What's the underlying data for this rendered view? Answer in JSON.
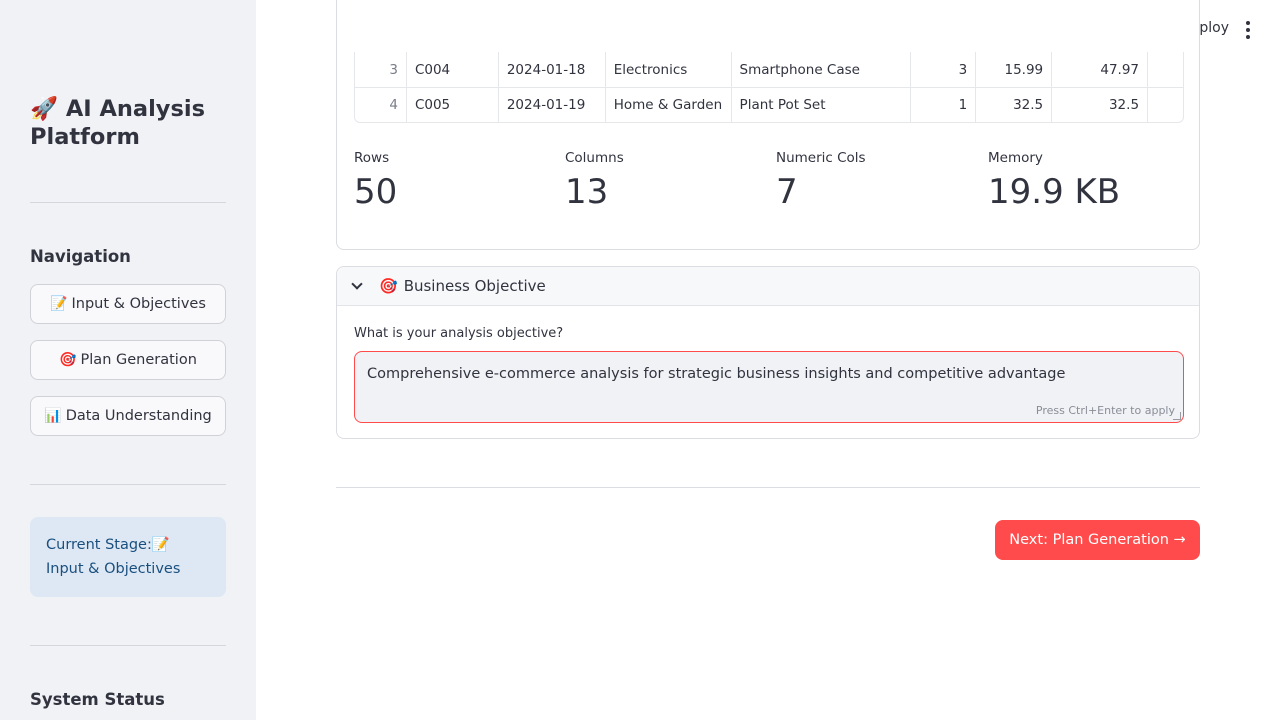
{
  "sidebar": {
    "title_icon": "🚀",
    "title": "AI Analysis Platform",
    "nav_heading": "Navigation",
    "nav_items": [
      {
        "icon": "📝",
        "label": "Input & Objectives"
      },
      {
        "icon": "🎯",
        "label": "Plan Generation"
      },
      {
        "icon": "📊",
        "label": "Data Understanding"
      }
    ],
    "current_stage_prefix": "Current Stage:",
    "current_stage_icon": "📝",
    "current_stage_value": "Input & Objectives",
    "status_heading": "System Status"
  },
  "header": {
    "deploy_label": "Deploy",
    "menu_icon": "kebab-menu-icon"
  },
  "table": {
    "rows": [
      {
        "index": "3",
        "cells": [
          "C004",
          "2024-01-18",
          "Electronics",
          "Smartphone Case",
          "3",
          "15.99",
          "47.97",
          ""
        ]
      },
      {
        "index": "4",
        "cells": [
          "C005",
          "2024-01-19",
          "Home & Garden",
          "Plant Pot Set",
          "1",
          "32.5",
          "32.5",
          ""
        ]
      }
    ]
  },
  "metrics": [
    {
      "label": "Rows",
      "value": "50"
    },
    {
      "label": "Columns",
      "value": "13"
    },
    {
      "label": "Numeric Cols",
      "value": "7"
    },
    {
      "label": "Memory",
      "value": "19.9 KB"
    }
  ],
  "objective": {
    "icon": "🎯",
    "title": "Business Objective",
    "field_label": "What is your analysis objective?",
    "value": "Comprehensive e-commerce analysis for strategic business insights and competitive advantage",
    "hint": "Press Ctrl+Enter to apply"
  },
  "next_button": "Next: Plan Generation →",
  "colors": {
    "accent": "#ff4b4b",
    "sidebar_bg": "#f0f2f6",
    "stage_bg": "#dde8f4",
    "stage_text": "#1a4f7e"
  }
}
